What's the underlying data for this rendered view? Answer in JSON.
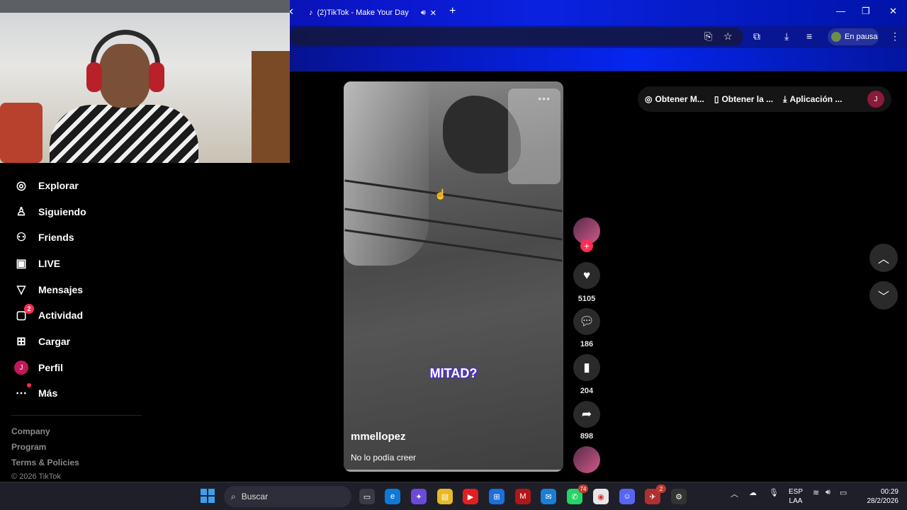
{
  "browser": {
    "tab_title": "(2)TikTok - Make Your Day",
    "profile_status": "En pausa",
    "accent": "#0b16c8"
  },
  "sidebar": {
    "items": [
      {
        "label": "Explorar",
        "icon": "compass-icon"
      },
      {
        "label": "Siguiendo",
        "icon": "following-icon"
      },
      {
        "label": "Friends",
        "icon": "friends-icon"
      },
      {
        "label": "LIVE",
        "icon": "live-icon"
      },
      {
        "label": "Mensajes",
        "icon": "send-icon"
      },
      {
        "label": "Actividad",
        "icon": "activity-icon",
        "badge": "2"
      },
      {
        "label": "Cargar",
        "icon": "upload-icon"
      },
      {
        "label": "Perfil",
        "icon": "avatar",
        "avatar_letter": "J"
      },
      {
        "label": "Más",
        "icon": "more-icon"
      }
    ],
    "footer_links": [
      "Company",
      "Program",
      "Terms & Policies"
    ],
    "copyright": "© 2026 TikTok"
  },
  "video": {
    "caption_word": "MITAD?",
    "username": "mmellopez",
    "description": "No lo podía creer"
  },
  "actions": {
    "likes": "5105",
    "comments": "186",
    "saves": "204",
    "shares": "898"
  },
  "top_pills": {
    "item1": "Obtener M...",
    "item2": "Obtener la ...",
    "item3": "Aplicación ...",
    "avatar_letter": "J"
  },
  "taskbar": {
    "search_placeholder": "Buscar",
    "whatsapp_badge": "74",
    "app_badge": "2",
    "lang_line1": "ESP",
    "lang_line2": "LAA",
    "time": "00:29",
    "date": "28/2/2026"
  }
}
